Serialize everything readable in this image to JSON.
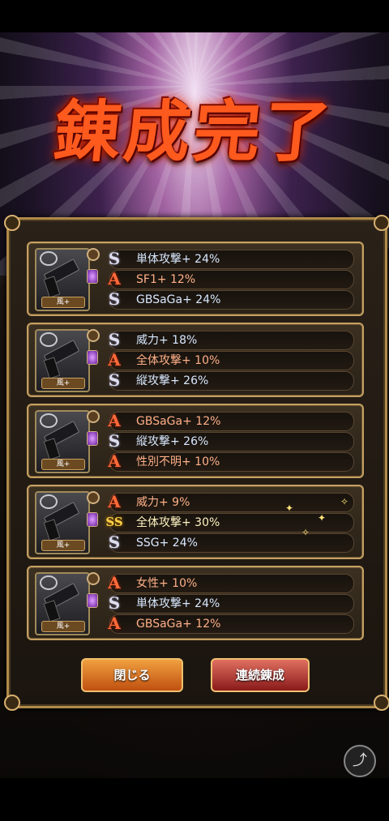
{
  "title": "錬成完了",
  "cards": [
    {
      "weapon_tag": "風+",
      "rows": [
        {
          "rank": "S",
          "text": "単体攻撃+ 24%",
          "tone": "blue"
        },
        {
          "rank": "A",
          "text": "SF1+ 12%",
          "tone": "red"
        },
        {
          "rank": "S",
          "text": "GBSaGa+ 24%",
          "tone": "blue"
        }
      ]
    },
    {
      "weapon_tag": "風+",
      "rows": [
        {
          "rank": "S",
          "text": "威力+ 18%",
          "tone": "blue"
        },
        {
          "rank": "A",
          "text": "全体攻撃+ 10%",
          "tone": "red"
        },
        {
          "rank": "S",
          "text": "縦攻撃+ 26%",
          "tone": "blue"
        }
      ]
    },
    {
      "weapon_tag": "風+",
      "rows": [
        {
          "rank": "A",
          "text": "GBSaGa+ 12%",
          "tone": "red"
        },
        {
          "rank": "S",
          "text": "縦攻撃+ 26%",
          "tone": "blue"
        },
        {
          "rank": "A",
          "text": "性別不明+ 10%",
          "tone": "red"
        }
      ]
    },
    {
      "weapon_tag": "風+",
      "rows": [
        {
          "rank": "A",
          "text": "威力+ 9%",
          "tone": "red"
        },
        {
          "rank": "SS",
          "text": "全体攻撃+ 30%",
          "tone": "gold"
        },
        {
          "rank": "S",
          "text": "SSG+ 24%",
          "tone": "blue"
        }
      ]
    },
    {
      "weapon_tag": "風+",
      "rows": [
        {
          "rank": "A",
          "text": "女性+ 10%",
          "tone": "red"
        },
        {
          "rank": "S",
          "text": "単体攻撃+ 24%",
          "tone": "blue"
        },
        {
          "rank": "A",
          "text": "GBSaGa+ 12%",
          "tone": "red"
        }
      ]
    }
  ],
  "buttons": {
    "close_label": "閉じる",
    "continue_label": "連続錬成"
  },
  "icons": {
    "share": "share-icon",
    "weapon": "gun-icon",
    "rank_s": "rank-s-icon",
    "rank_a": "rank-a-icon",
    "rank_ss": "rank-ss-icon"
  },
  "colors": {
    "title": "#ff5a1e",
    "frame": "#c4a062",
    "close_button": "#e07a2a",
    "continue_button": "#b83a2a"
  }
}
